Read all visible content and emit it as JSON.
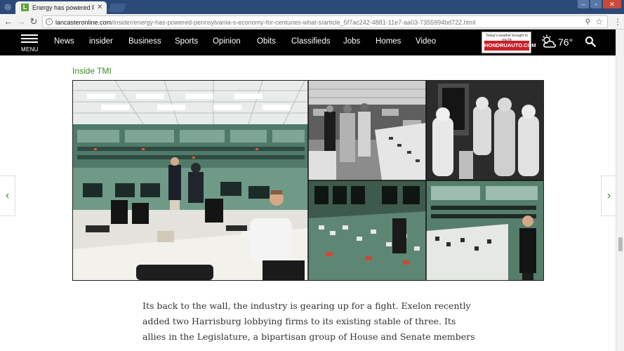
{
  "browser": {
    "tab_title": "Energy has powered Pen",
    "tab_close": "✕",
    "url_host": "lancasteronline.com",
    "url_path": "/insider/energy-has-powered-pennsylvania-s-economy-for-centuries-what-s/article_5f7ac242-4881-11e7-aa03-7355994bd722.html"
  },
  "sitenav": {
    "menu_label": "MENU",
    "items": [
      "News",
      "insider",
      "Business",
      "Sports",
      "Opinion",
      "Obits",
      "Classifieds",
      "Jobs",
      "Homes",
      "Video"
    ],
    "ad_small_text": "Today's weather brought to you by",
    "ad_brand": "HONDRUAUTO.COM",
    "temperature": "76°"
  },
  "article": {
    "section_label": "Inside TMI",
    "paragraph": "Its back to the wall, the industry is gearing up for a fight. Exelon recently added two Harrisburg lobbying firms to its existing stable of three. Its allies in the Legislature, a bipartisan group of House and Senate members"
  },
  "nav_arrows": {
    "left": "‹",
    "right": "›"
  },
  "colors": {
    "accent_green": "#3d8a2a",
    "nav_bg": "#000000",
    "tab_bar": "#2b4a78"
  }
}
